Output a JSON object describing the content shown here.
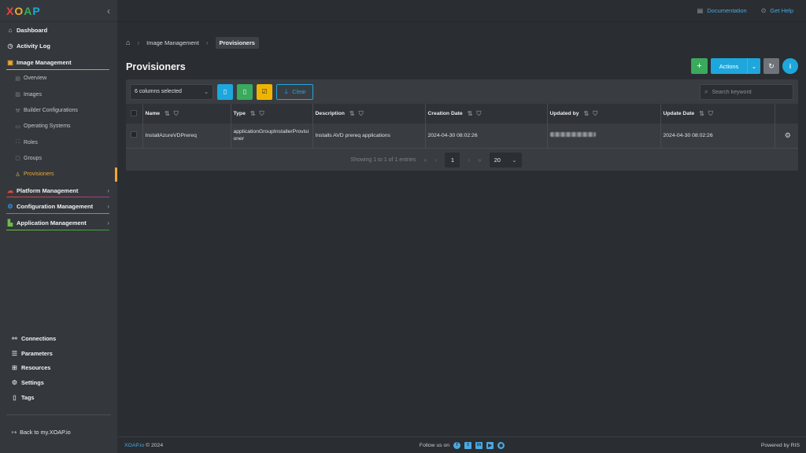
{
  "sidebar": {
    "logo": "XOAP",
    "logo_colors": [
      "#e8463b",
      "#f0a830",
      "#3aaa5c",
      "#1ea7dc"
    ],
    "collapse_icon": "chevron-left-icon",
    "items": [
      {
        "label": "Dashboard",
        "icon": "home-icon"
      },
      {
        "label": "Activity Log",
        "icon": "clock-icon"
      },
      {
        "label": "Image Management",
        "icon": "images-icon"
      }
    ],
    "sub_items": [
      {
        "label": "Overview"
      },
      {
        "label": "Images"
      },
      {
        "label": "Builder Configurations"
      },
      {
        "label": "Operating Systems"
      },
      {
        "label": "Roles"
      },
      {
        "label": "Groups"
      },
      {
        "label": "Provisioners"
      }
    ],
    "groups": [
      {
        "label": "Platform Management"
      },
      {
        "label": "Configuration Management"
      },
      {
        "label": "Application Management"
      }
    ],
    "bottom_items": [
      {
        "label": "Connections"
      },
      {
        "label": "Parameters"
      },
      {
        "label": "Resources"
      },
      {
        "label": "Settings"
      },
      {
        "label": "Tags"
      }
    ],
    "back_link": "Back to my.XOAP.io"
  },
  "topbar": {
    "documentation": "Documentation",
    "get_help": "Get Help"
  },
  "breadcrumb": [
    "Image Management",
    "Provisioners"
  ],
  "page": {
    "title": "Provisioners",
    "actions_label": "Actions"
  },
  "toolbar": {
    "columns_selected": "6 columns selected",
    "clear_label": "Clear",
    "search_placeholder": "Search keyword"
  },
  "table": {
    "columns": [
      "Name",
      "Type",
      "Description",
      "Creation Date",
      "Updated by",
      "Update Date"
    ],
    "rows": [
      {
        "name": "InstallAzureVDPrereq",
        "type": "applicationGroupInstallerProvisioner",
        "description": "Installs AVD prereq applications",
        "creation_date": "2024-04-30 08:02:26",
        "updated_by": "",
        "update_date": "2024-04-30 08:02:26"
      }
    ]
  },
  "pagination": {
    "summary": "Showing 1 to 1 of 1 entries",
    "current_page": "1",
    "per_page": "20"
  },
  "footer": {
    "brand": "XOAP.io",
    "copyright": "© 2024",
    "follow_us": "Follow us on",
    "powered_by": "Powered by RIS"
  },
  "colors": {
    "accent_blue": "#1ea7dc",
    "accent_green": "#3aaa5c",
    "accent_orange": "#f0a830"
  }
}
